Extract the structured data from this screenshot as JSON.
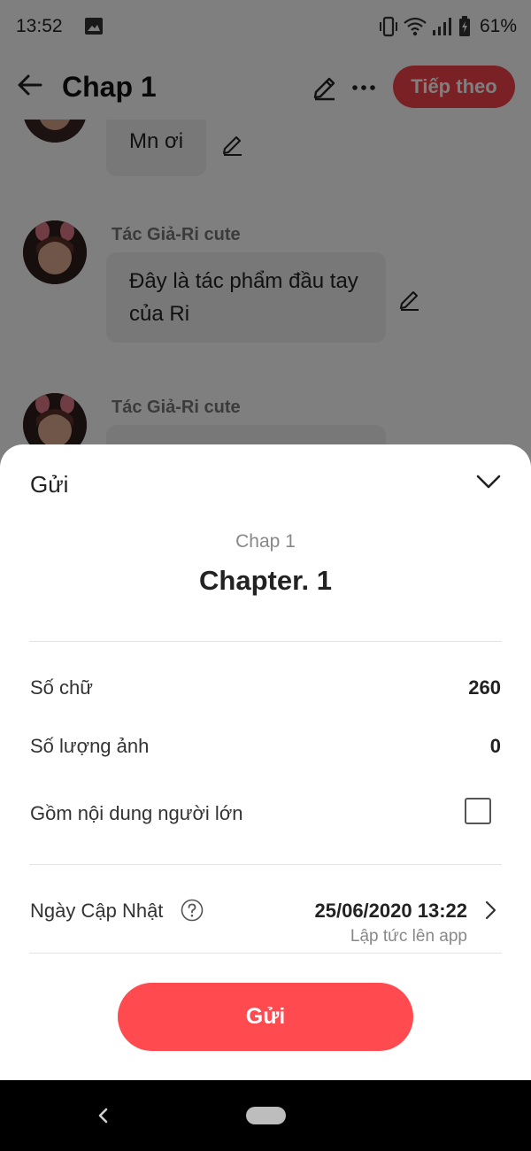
{
  "status_bar": {
    "time": "13:52",
    "battery_percent": "61%",
    "icons": [
      "gallery-icon",
      "vibrate-icon",
      "wifi-icon",
      "signal-icon",
      "battery-icon"
    ]
  },
  "app_bar": {
    "title": "Chap 1",
    "next_label": "Tiếp theo",
    "icons": [
      "back-arrow-icon",
      "pencil-icon",
      "more-icon"
    ],
    "accent_color": "#f5424b"
  },
  "messages": [
    {
      "author": "",
      "text": "Mn ơi"
    },
    {
      "author": "Tác Giả-Ri cute",
      "text": "Đây là tác phẩm đầu tay của Ri"
    },
    {
      "author": "Tác Giả-Ri cute",
      "text": ""
    }
  ],
  "sheet": {
    "title": "Gửi",
    "chapter_subtitle": "Chap 1",
    "chapter_name": "Chapter. 1",
    "word_count_label": "Số chữ",
    "word_count_value": "260",
    "image_count_label": "Số lượng ảnh",
    "image_count_value": "0",
    "adult_content_label": "Gồm nội dung người lớn",
    "adult_content_checked": false,
    "update_date_label": "Ngày Cập Nhật",
    "update_date_value": "25/06/2020 13:22",
    "update_date_note": "Lập tức lên app",
    "submit_label": "Gửi",
    "submit_color": "#ff4a4f"
  }
}
